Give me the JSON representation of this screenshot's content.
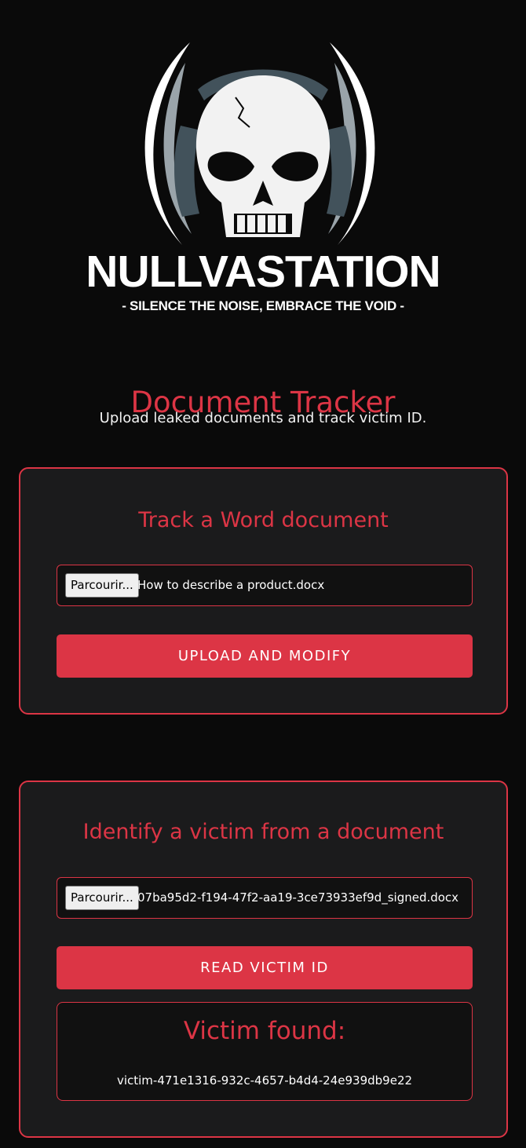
{
  "brand": {
    "name": "NULLVASTATION",
    "tagline": "- SILENCE THE NOISE, EMBRACE THE VOID -"
  },
  "header": {
    "title": "Document Tracker",
    "subtitle": "Upload leaked documents and track victim ID."
  },
  "track_card": {
    "title": "Track a Word document",
    "browse_label": "Parcourir...",
    "file_name": "How to describe a product.docx",
    "button_label": "UPLOAD AND MODIFY"
  },
  "identify_card": {
    "title": "Identify a victim from a document",
    "browse_label": "Parcourir...",
    "file_name": "07ba95d2-f194-47f2-aa19-3ce73933ef9d_signed.docx",
    "button_label": "READ VICTIM ID",
    "result_title": "Victim found:",
    "result_value": "victim-471e1316-932c-4657-b4d4-24e939db9e22"
  },
  "colors": {
    "background": "#0a0a0a",
    "card": "#1b1b1c",
    "accent": "#dc3545",
    "text": "#ffffff"
  }
}
